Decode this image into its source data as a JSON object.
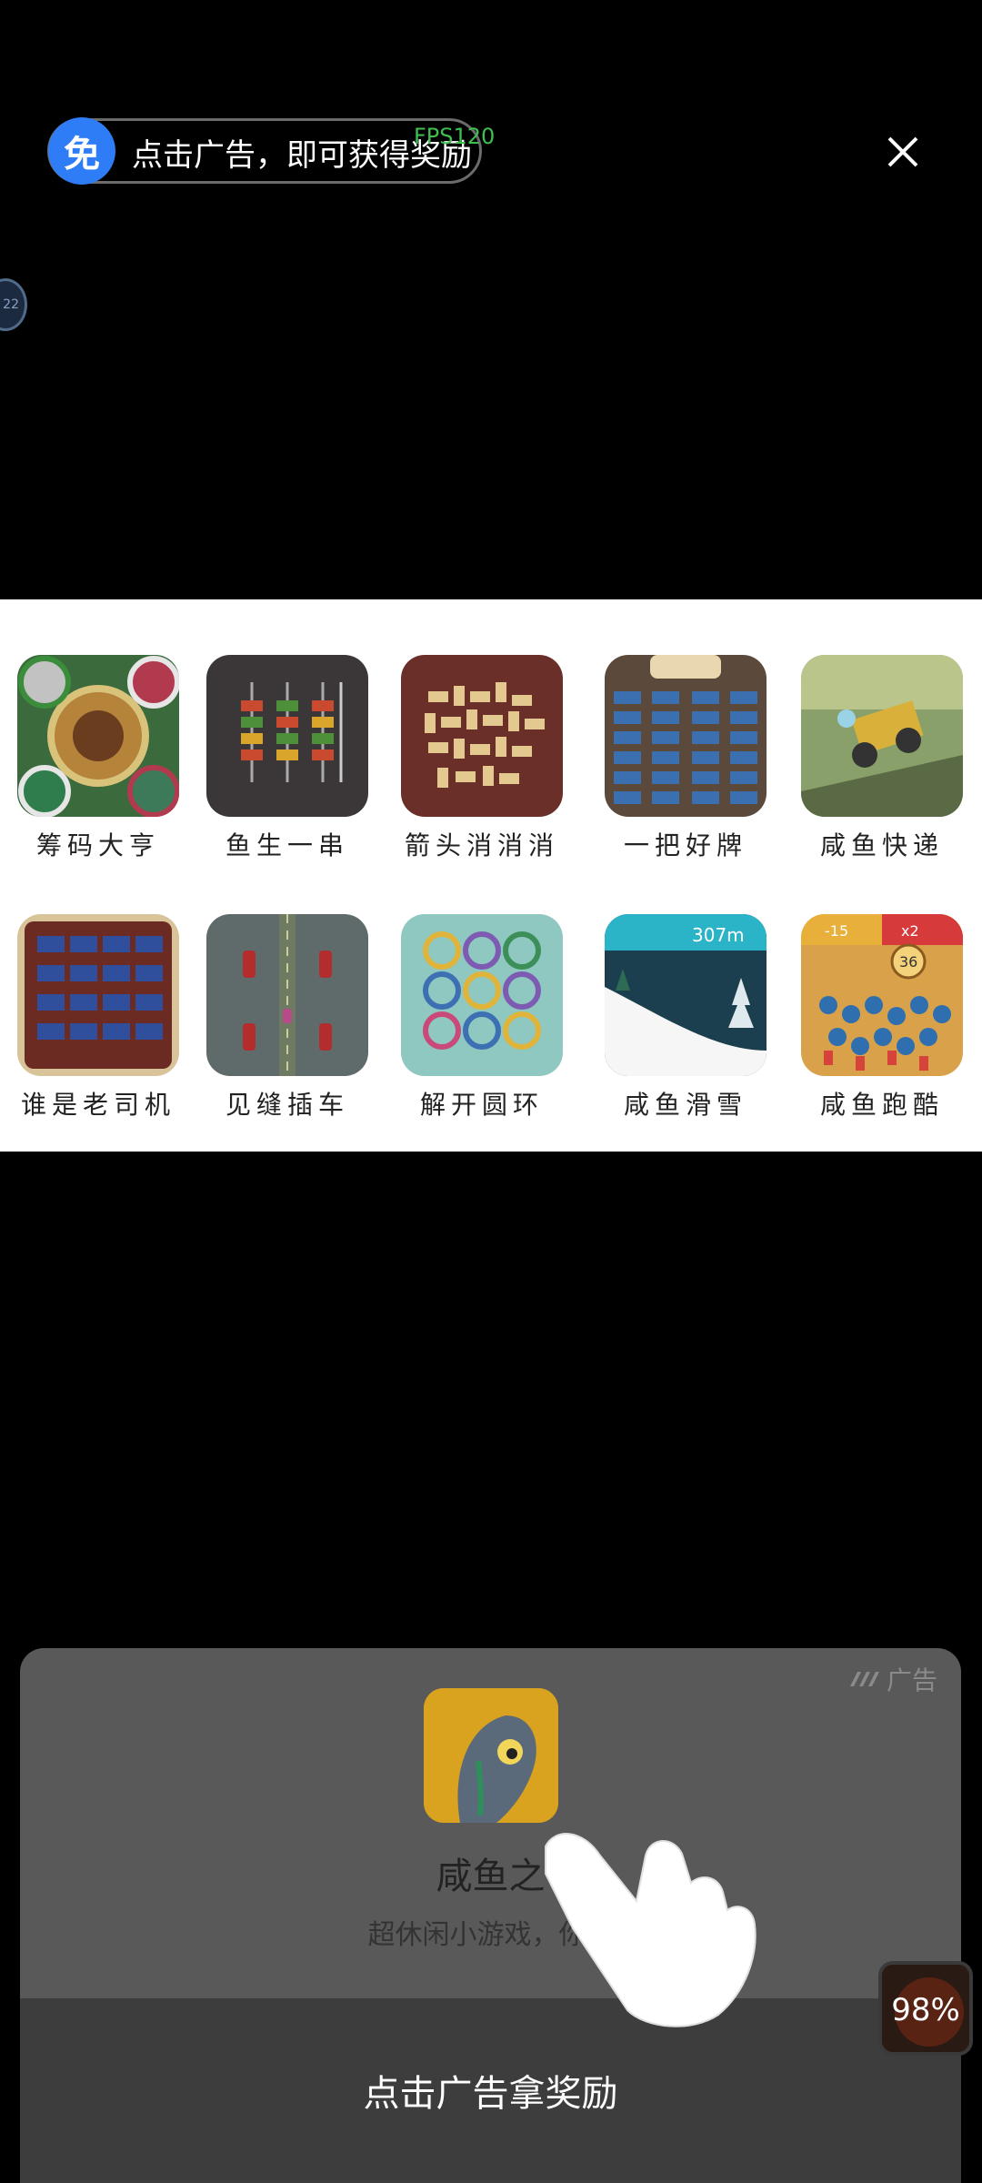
{
  "top": {
    "badge": "免",
    "reward_text": "点击广告，即可获得奖励",
    "fps": "FPS120",
    "side_bubble": "22"
  },
  "games": [
    {
      "label": "筹码大亨",
      "icon": "poker-chips-icon"
    },
    {
      "label": "鱼生一串",
      "icon": "skewer-icon"
    },
    {
      "label": "箭头消消消",
      "icon": "arrow-blocks-icon"
    },
    {
      "label": "一把好牌",
      "icon": "card-grid-icon"
    },
    {
      "label": "咸鱼快递",
      "icon": "delivery-truck-icon"
    },
    {
      "label": "谁是老司机",
      "icon": "driver-keyboard-icon"
    },
    {
      "label": "见缝插车",
      "icon": "road-cars-icon"
    },
    {
      "label": "解开圆环",
      "icon": "rings-icon"
    },
    {
      "label": "咸鱼滑雪",
      "icon": "ski-slope-icon"
    },
    {
      "label": "咸鱼跑酷",
      "icon": "crowd-run-icon"
    }
  ],
  "ad": {
    "tag": "广告",
    "app_name": "咸鱼之",
    "app_desc": "超休闲小游戏，你能",
    "cta": "点击广告拿奖励",
    "progress": "98%"
  }
}
